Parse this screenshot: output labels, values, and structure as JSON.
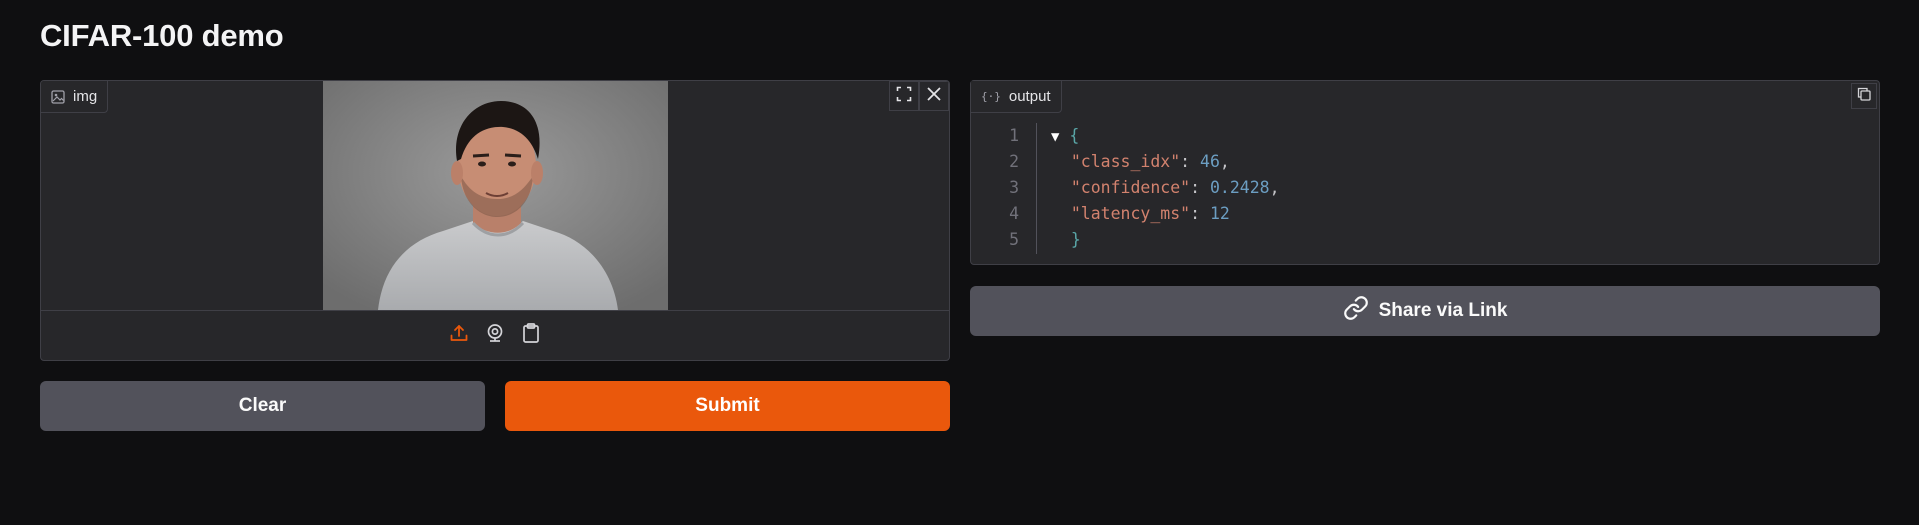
{
  "app": {
    "title": "CIFAR-100 demo"
  },
  "input": {
    "label": "img",
    "icons": [
      "image-icon",
      "fullscreen-icon",
      "close-icon",
      "upload-icon",
      "webcam-icon",
      "clipboard-icon"
    ]
  },
  "output": {
    "label": "output",
    "lines": [
      {
        "num": "1",
        "open": "{"
      },
      {
        "num": "2",
        "key": "\"class_idx\"",
        "value": "46",
        "comma": ","
      },
      {
        "num": "3",
        "key": "\"confidence\"",
        "value": "0.2428",
        "comma": ","
      },
      {
        "num": "4",
        "key": "\"latency_ms\"",
        "value": "12",
        "comma": ""
      },
      {
        "num": "5",
        "close": "}"
      }
    ]
  },
  "buttons": {
    "clear": "Clear",
    "submit": "Submit",
    "share": "Share via Link"
  },
  "colors": {
    "accent": "#ea580c",
    "background": "#0f0f11",
    "panel": "#27272a"
  }
}
